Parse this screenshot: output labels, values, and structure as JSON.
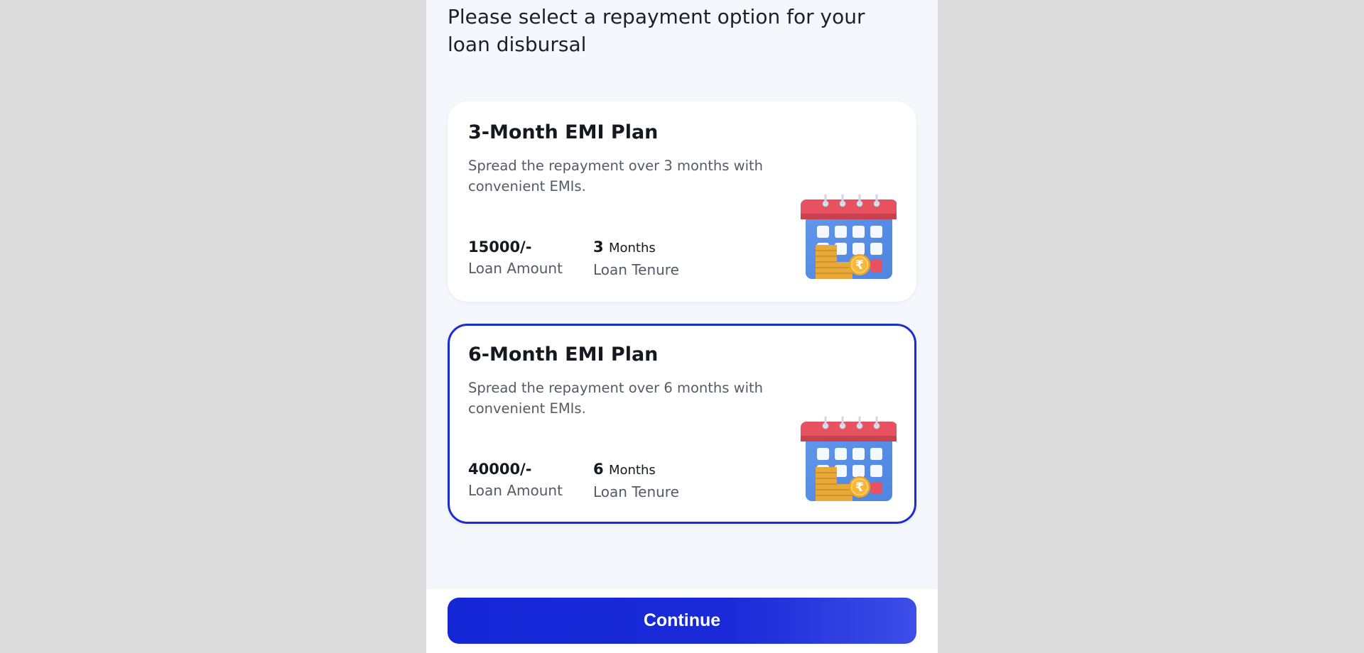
{
  "page": {
    "heading": "Please select a repayment option for your loan disbursal"
  },
  "plans": [
    {
      "title": "3-Month EMI Plan",
      "description": "Spread the repayment over 3 months with convenient EMIs.",
      "amount_value": "15000/-",
      "amount_label": "Loan Amount",
      "tenure_value": "3",
      "tenure_unit": "Months",
      "tenure_label": "Loan Tenure",
      "selected": false,
      "icon": "calendar-coins-icon"
    },
    {
      "title": "6-Month EMI Plan",
      "description": "Spread the repayment over 6 months with convenient EMIs.",
      "amount_value": "40000/-",
      "amount_label": "Loan Amount",
      "tenure_value": "6",
      "tenure_unit": "Months",
      "tenure_label": "Loan Tenure",
      "selected": true,
      "icon": "calendar-coins-icon"
    }
  ],
  "footer": {
    "continue_label": "Continue"
  },
  "colors": {
    "accent": "#1c2bd2",
    "page_background": "#f4f7fc",
    "outer_background": "#dcdcdc"
  }
}
